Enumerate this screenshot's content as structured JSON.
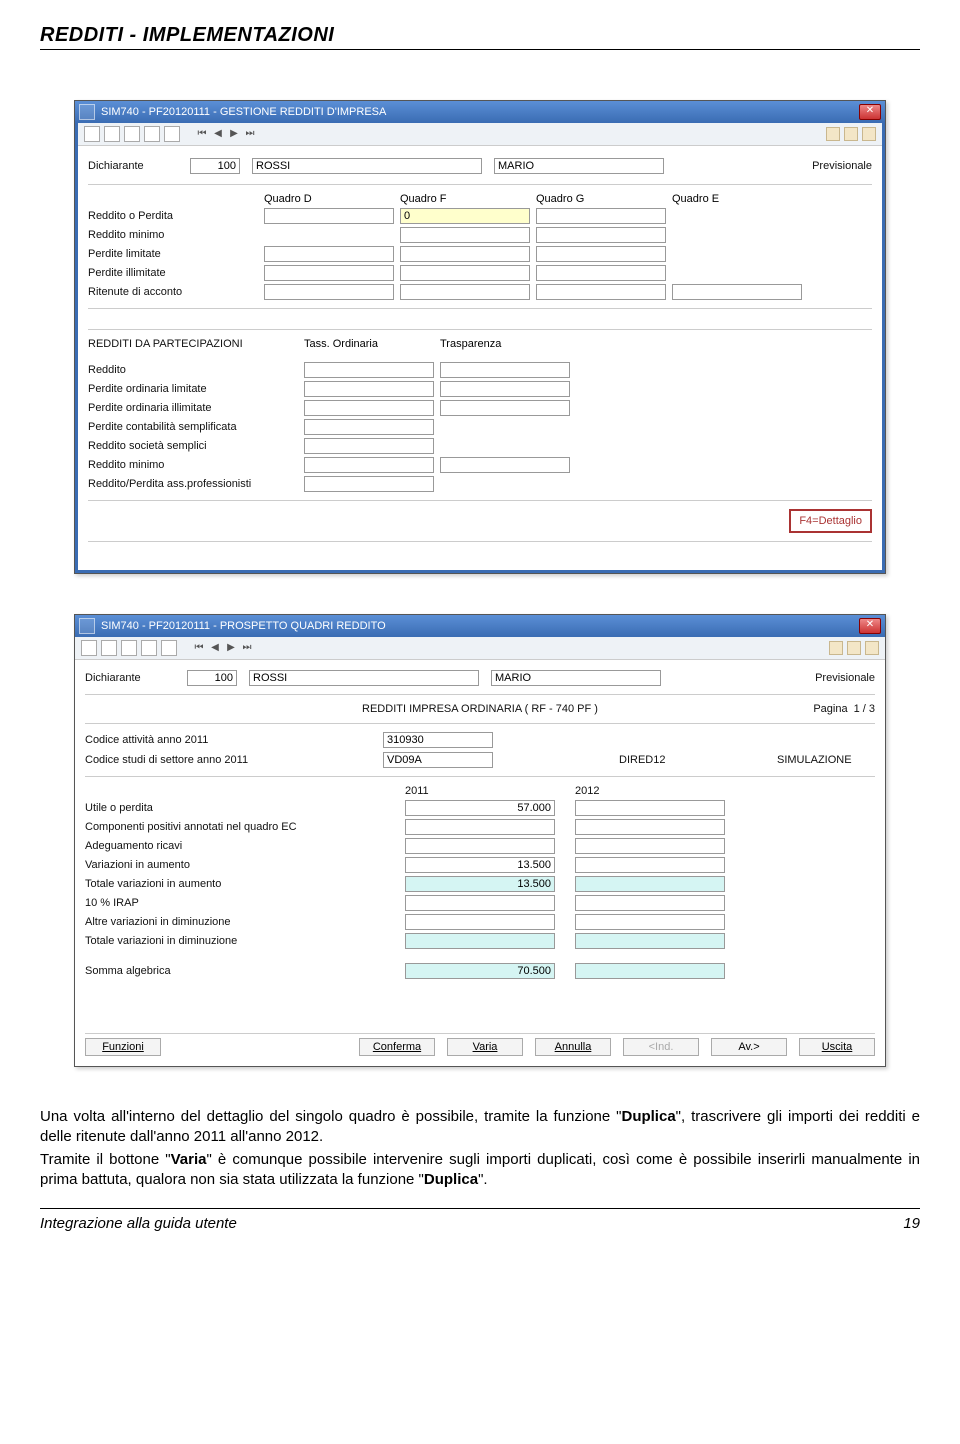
{
  "doc": {
    "header": "REDDITI - IMPLEMENTAZIONI",
    "paragraph_before": "Una volta all'interno del dettaglio del singolo quadro è possibile, tramite la funzione \"",
    "bold1": "Duplica",
    "paragraph_mid1": "\", trascrivere gli importi dei redditi e delle ritenute dall'anno 2011 all'anno 2012.",
    "paragraph2_before": "Tramite il bottone \"",
    "bold2": "Varia",
    "paragraph2_mid": "\" è comunque possibile intervenire sugli importi duplicati, così come è possibile inserirli manualmente in prima battuta, qualora non sia stata utilizzata la funzione \"",
    "bold3": "Duplica",
    "paragraph2_after": "\".",
    "footer_left": "Integrazione alla guida utente",
    "footer_right": "19"
  },
  "win1": {
    "title": "SIM740  - PF20120111 - GESTIONE REDDITI D'IMPRESA",
    "declarant_label": "Dichiarante",
    "code": "100",
    "surname": "ROSSI",
    "name": "MARIO",
    "previsionale": "Previsionale",
    "quadri": {
      "headers": [
        "Quadro D",
        "Quadro F",
        "Quadro G",
        "Quadro E"
      ],
      "rows": [
        {
          "label": "Reddito o Perdita",
          "vals": [
            "",
            "0",
            "",
            ""
          ]
        },
        {
          "label": "Reddito minimo",
          "vals": [
            "",
            "",
            "",
            ""
          ]
        },
        {
          "label": "Perdite limitate",
          "vals": [
            "",
            "",
            "",
            ""
          ]
        },
        {
          "label": "Perdite illimitate",
          "vals": [
            "",
            "",
            "",
            ""
          ]
        },
        {
          "label": "Ritenute di acconto",
          "vals": [
            "",
            "",
            "",
            ""
          ]
        }
      ]
    },
    "part": {
      "title": "REDDITI DA PARTECIPAZIONI",
      "headers": [
        "Tass. Ordinaria",
        "Trasparenza"
      ],
      "rows": [
        {
          "label": "Reddito"
        },
        {
          "label": "Perdite ordinaria limitate"
        },
        {
          "label": "Perdite ordinaria illimitate"
        },
        {
          "label": "Perdite contabilità semplificata"
        },
        {
          "label": "Reddito società semplici"
        },
        {
          "label": "Reddito minimo"
        },
        {
          "label": "Reddito/Perdita ass.professionisti"
        }
      ]
    },
    "dettaglio_btn": "F4=Dettaglio"
  },
  "win2": {
    "title": "SIM740 - PF20120111 -  PROSPETTO QUADRI REDDITO",
    "declarant_label": "Dichiarante",
    "code": "100",
    "surname": "ROSSI",
    "name": "MARIO",
    "previsionale": "Previsionale",
    "subtitle": "REDDITI IMPRESA ORDINARIA ( RF - 740 PF )",
    "page_label": "Pagina",
    "page_val": "1 / 3",
    "codici": {
      "r1_label": "Codice attività anno 2011",
      "r1_val": "310930",
      "r2_label": "Codice studi di settore anno 2011",
      "r2_val": "VD09A",
      "dired": "DIRED12",
      "sim": "SIMULAZIONE"
    },
    "years": {
      "y1": "2011",
      "y2": "2012"
    },
    "rows": [
      {
        "label": "Utile o perdita",
        "v1": "57.000",
        "v2": "",
        "cyan": false
      },
      {
        "label": "Componenti positivi annotati nel quadro EC",
        "v1": "",
        "v2": "",
        "cyan": false
      },
      {
        "label": "Adeguamento ricavi",
        "v1": "",
        "v2": "",
        "cyan": false
      },
      {
        "label": "Variazioni in aumento",
        "v1": "13.500",
        "v2": "",
        "cyan": false
      },
      {
        "label": "Totale variazioni in aumento",
        "v1": "13.500",
        "v2": "",
        "cyan": true
      },
      {
        "label": "10 % IRAP",
        "v1": "",
        "v2": "",
        "cyan": false
      },
      {
        "label": "Altre variazioni in diminuzione",
        "v1": "",
        "v2": "",
        "cyan": false
      },
      {
        "label": "Totale variazioni in diminuzione",
        "v1": "",
        "v2": "",
        "cyan": true
      }
    ],
    "somma_label": "Somma algebrica",
    "somma_val": "70.500",
    "buttons": {
      "funzioni": "Funzioni",
      "conferma": "Conferma",
      "varia": "Varia",
      "annulla": "Annulla",
      "ind": "<Ind.",
      "av": "Av.>",
      "uscita": "Uscita"
    }
  }
}
